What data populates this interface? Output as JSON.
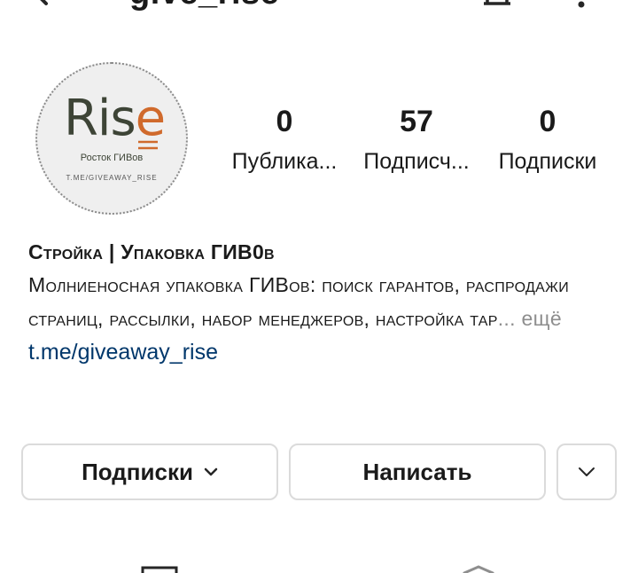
{
  "header": {
    "username": "give_rise",
    "back_icon": "arrow-back-icon",
    "bell_icon": "bell-icon",
    "more_icon": "more-vertical-icon"
  },
  "avatar": {
    "logo_text": "Ris",
    "logo_accent_letter": "e",
    "subtitle": "Росток ГИВов",
    "link": "T.ME/GIVEAWAY_RISE",
    "accent_color": "#d06a2c"
  },
  "stats": [
    {
      "value": "0",
      "label": "Публика..."
    },
    {
      "value": "57",
      "label": "Подписч..."
    },
    {
      "value": "0",
      "label": "Подписки"
    }
  ],
  "bio": {
    "name": "Стройка | Упаковка ГИВ0в",
    "text": "Молниеносная упаковка ГИВов: поиск гарантов, распродажи страниц, рассылки, набор менеджеров, настройка тар",
    "ellipsis": "...",
    "more": "ещё",
    "link": "t.me/giveaway_rise",
    "link_color": "#00376b"
  },
  "buttons": {
    "following_label": "Подписки",
    "message_label": "Написать",
    "more_icon": "chevron-down-icon"
  },
  "tabs": [
    {
      "icon": "grid-icon"
    },
    {
      "icon": "tagged-icon"
    }
  ]
}
